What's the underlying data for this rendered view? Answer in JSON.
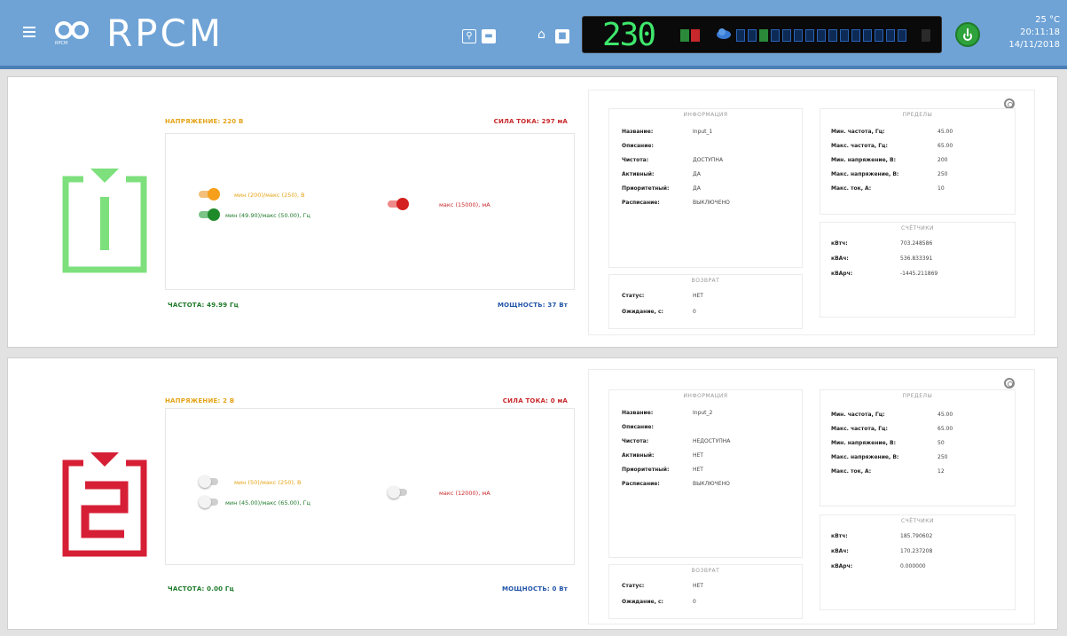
{
  "app": {
    "brand": "RPCM",
    "logo_caption": "RPCM"
  },
  "topbar": {
    "home_glyph": "⌂",
    "display_voltage": "230",
    "temperature": "25 °C",
    "time": "20:11:18",
    "date": "14/11/2018"
  },
  "outlets": [
    {
      "number": "1",
      "accent": "#7de07d",
      "voltage_label": "НАПРЯЖЕНИЕ: 220 В",
      "current_label": "СИЛА ТОКА: 297 мА",
      "frequency_label": "ЧАСТОТА: 49.99 Гц",
      "power_label": "МОЩНОСТЬ: 37 Вт",
      "voltage_toggle": "мин (200)/макс (250), В",
      "frequency_toggle": "мин (49.90)/макс (50.00), Гц",
      "current_toggle": "макс (15000), мА",
      "info": {
        "title": "ИНФОРМАЦИЯ",
        "rows": [
          {
            "k": "Название:",
            "v": "Input_1"
          },
          {
            "k": "Описание:",
            "v": ""
          },
          {
            "k": "Чистота:",
            "v": "ДОСТУПНА"
          },
          {
            "k": "Активный:",
            "v": "ДА"
          },
          {
            "k": "Приоритетный:",
            "v": "ДА"
          },
          {
            "k": "Расписание:",
            "v": "ВЫКЛЮЧЕНО"
          }
        ]
      },
      "limits": {
        "title": "ПРЕДЕЛЫ",
        "rows": [
          {
            "k": "Мин. частота, Гц:",
            "v": "45.00"
          },
          {
            "k": "Макс. частота, Гц:",
            "v": "65.00"
          },
          {
            "k": "Мин. напряжение, В:",
            "v": "200"
          },
          {
            "k": "Макс. напряжение, В:",
            "v": "250"
          },
          {
            "k": "Макс. ток, А:",
            "v": "10"
          }
        ]
      },
      "counters": {
        "title": "СЧЁТЧИКИ",
        "rows": [
          {
            "k": "кВтч:",
            "v": "703.248586"
          },
          {
            "k": "кВАч:",
            "v": "536.833391"
          },
          {
            "k": "кВАрч:",
            "v": "-1445.211869"
          }
        ]
      },
      "fallback": {
        "title": "ВОЗВРАТ",
        "rows": [
          {
            "k": "Статус:",
            "v": "НЕТ"
          },
          {
            "k": "Ожидание, с:",
            "v": "0"
          }
        ]
      }
    },
    {
      "number": "2",
      "accent": "#d61f35",
      "voltage_label": "НАПРЯЖЕНИЕ: 2 В",
      "current_label": "СИЛА ТОКА: 0 мА",
      "frequency_label": "ЧАСТОТА: 0.00 Гц",
      "power_label": "МОЩНОСТЬ: 0 Вт",
      "voltage_toggle": "мин (50)/макс (250), В",
      "frequency_toggle": "мин (45.00)/макс (65.00), Гц",
      "current_toggle": "макс (12000), мА",
      "info": {
        "title": "ИНФОРМАЦИЯ",
        "rows": [
          {
            "k": "Название:",
            "v": "Input_2"
          },
          {
            "k": "Описание:",
            "v": ""
          },
          {
            "k": "Чистота:",
            "v": "НЕДОСТУПНА"
          },
          {
            "k": "Активный:",
            "v": "НЕТ"
          },
          {
            "k": "Приоритетный:",
            "v": "НЕТ"
          },
          {
            "k": "Расписание:",
            "v": "ВЫКЛЮЧЕНО"
          }
        ]
      },
      "limits": {
        "title": "ПРЕДЕЛЫ",
        "rows": [
          {
            "k": "Мин. частота, Гц:",
            "v": "45.00"
          },
          {
            "k": "Макс. частота, Гц:",
            "v": "65.00"
          },
          {
            "k": "Мин. напряжение, В:",
            "v": "50"
          },
          {
            "k": "Макс. напряжение, В:",
            "v": "250"
          },
          {
            "k": "Макс. ток, А:",
            "v": "12"
          }
        ]
      },
      "counters": {
        "title": "СЧЁТЧИКИ",
        "rows": [
          {
            "k": "кВтч:",
            "v": "185.790602"
          },
          {
            "k": "кВАч:",
            "v": "170.237208"
          },
          {
            "k": "кВАрч:",
            "v": "0.000000"
          }
        ]
      },
      "fallback": {
        "title": "ВОЗВРАТ",
        "rows": [
          {
            "k": "Статус:",
            "v": "НЕТ"
          },
          {
            "k": "Ожидание, с:",
            "v": "0"
          }
        ]
      }
    }
  ],
  "icons": {
    "menu": "menu-icon",
    "location": "location-pin-icon",
    "keyboard": "keyboard-icon",
    "home": "home-icon",
    "power": "power-icon",
    "settings": "gear-icon"
  }
}
